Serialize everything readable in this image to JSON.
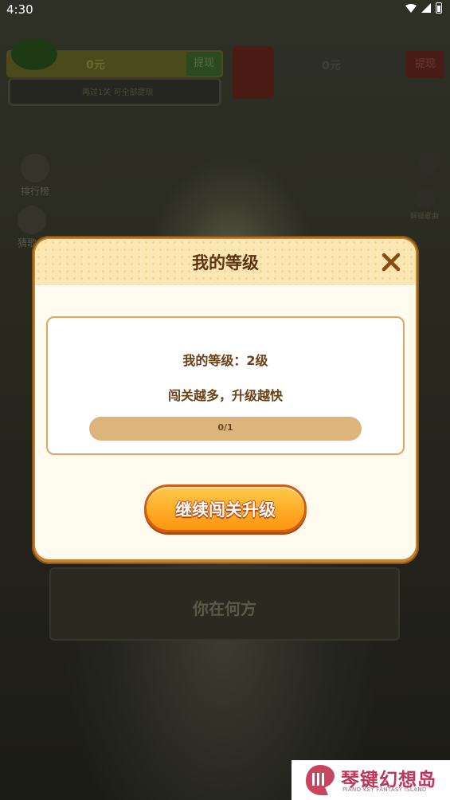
{
  "status_bar": {
    "time": "4:30"
  },
  "background": {
    "wallet_left": {
      "coins": "0元",
      "withdraw": "提现"
    },
    "wallet_note": "再过1关 可全部提现",
    "wallet_right": {
      "coins": "0元",
      "withdraw": "提现"
    },
    "side_items": [
      "排行榜",
      "猜歌曲"
    ],
    "lock_label": "解锁歌曲",
    "answer_option": "你在何方"
  },
  "modal": {
    "title": "我的等级",
    "level_label": "我的等级：2级",
    "hint": "闯关越多，升级越快",
    "progress": {
      "text": "0/1",
      "current": 0,
      "total": 1
    },
    "continue_button": "继续闯关升级"
  },
  "watermark": {
    "title": "琴键幻想岛",
    "subtitle": "PIANO KEY FANTASY ISLAND"
  },
  "colors": {
    "modal_border": "#c8812e",
    "header_bg": "#fbe7b3",
    "title_text": "#5c3414",
    "card_border": "#e2a45e",
    "progress_track": "#dcb57c",
    "button_top": "#ffc94a",
    "button_bottom": "#fb9612",
    "close_icon": "#8a4a14"
  }
}
